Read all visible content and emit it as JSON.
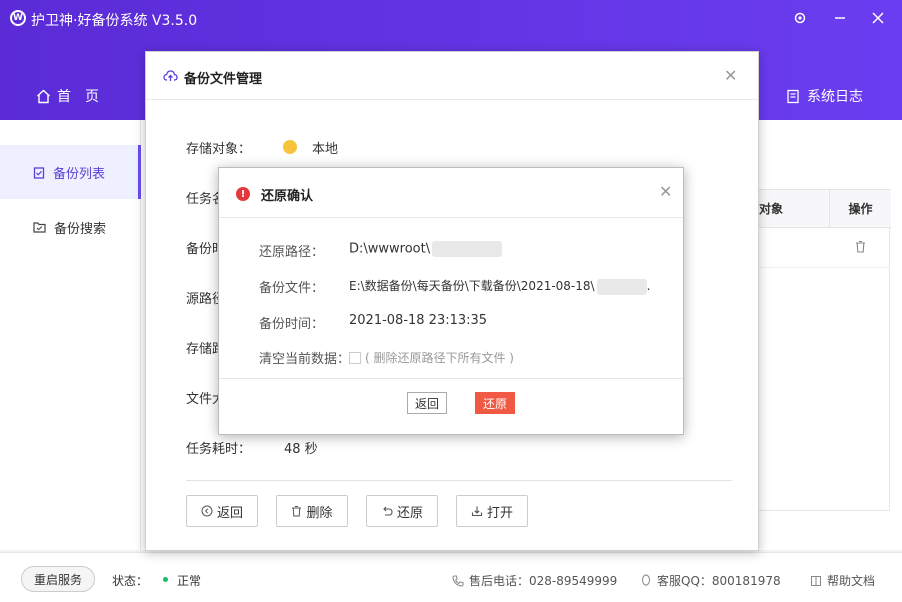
{
  "app": {
    "title": "护卫神·好备份系统 V3.5.0"
  },
  "nav": {
    "home": "首页",
    "log": "系统日志"
  },
  "sidebar": {
    "items": [
      {
        "label": "备份列表"
      },
      {
        "label": "备份搜索"
      }
    ]
  },
  "bg_table": {
    "col_object": "对象",
    "col_action": "操作"
  },
  "statusbar": {
    "restart": "重启服务",
    "status_label": "状态：",
    "status_value": "正常",
    "phone": "售后电话：028-89549999",
    "qq": "客服QQ：800181978",
    "help": "帮助文档"
  },
  "dialog": {
    "title": "备份文件管理",
    "fields": {
      "storage_label": "存储对象：",
      "storage_value": "本地",
      "task_label": "任务名",
      "time_label": "备份时",
      "src_label": "源路径",
      "store_label": "存储路",
      "size_label": "文件大",
      "duration_label": "任务耗时：",
      "duration_value": "48 秒"
    },
    "buttons": {
      "back": "返回",
      "delete": "删除",
      "restore": "还原",
      "open": "打开"
    }
  },
  "confirm": {
    "title": "还原确认",
    "path_label": "还原路径：",
    "path_value": "D:\\wwwroot\\",
    "file_label": "备份文件：",
    "file_value": "E:\\数据备份\\每天备份\\下载备份\\2021-08-18\\",
    "file_suffix": ".",
    "time_label": "备份时间：",
    "time_value": "2021-08-18 23:13:35",
    "clear_label": "清空当前数据：",
    "clear_hint": "( 删除还原路径下所有文件 )",
    "back": "返回",
    "ok": "还原"
  },
  "colors": {
    "brand": "#6a3df0",
    "danger": "#e4393c",
    "confirm_button": "#f05a45",
    "status_ok": "#19be6b"
  }
}
